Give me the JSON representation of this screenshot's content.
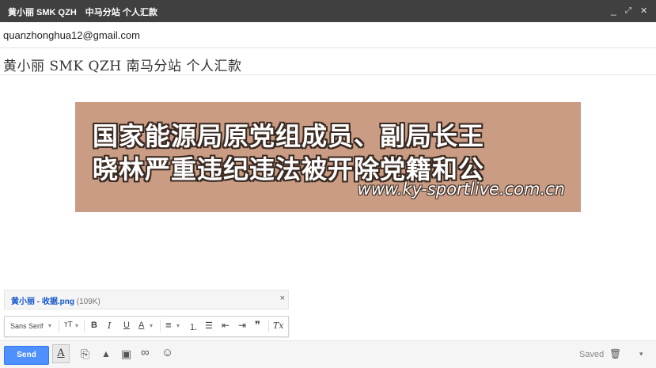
{
  "window": {
    "title": "黄小丽 SMK QZH　中马分站 个人汇款",
    "minimize_symbol": "_",
    "popout_symbol": "⤢",
    "close_symbol": "✕"
  },
  "compose": {
    "to": "quanzhonghua12@gmail.com",
    "subject": "黄小丽  SMK QZH  南马分站  个人汇款"
  },
  "banner": {
    "line1": "国家能源局原党组成员、副局长王",
    "line2": "晓林严重违纪违法被开除党籍和公",
    "url": "www.ky-sportlive.com.cn",
    "bg_color": "#c99c83"
  },
  "attachment": {
    "name": "黄小丽 - 收据.png",
    "size": "(109K)",
    "close_symbol": "×"
  },
  "format_bar": {
    "font_select": "Sans Serif",
    "font_arrow": "▾",
    "size": "тT",
    "size_arrow": "▾",
    "bold": "B",
    "italic": "I",
    "underline": "U",
    "text_color": "A",
    "text_color_arrow": "▾",
    "align": "≡",
    "align_arrow": "▾",
    "numbered_list": "⒈",
    "bulleted_list": "☰",
    "indent_less": "⇤",
    "indent_more": "⇥",
    "quote": "❞",
    "clear_format": "Tx"
  },
  "bottom_bar": {
    "send_label": "Send",
    "formatting_toggle": "A",
    "attach_icon": "⎘",
    "drive_icon": "▲",
    "photo_icon": "▣",
    "link_icon": "∞",
    "emoji_icon": "☺",
    "saved_label": "Saved",
    "discard_icon": "🗑",
    "more_arrow": "▾"
  }
}
